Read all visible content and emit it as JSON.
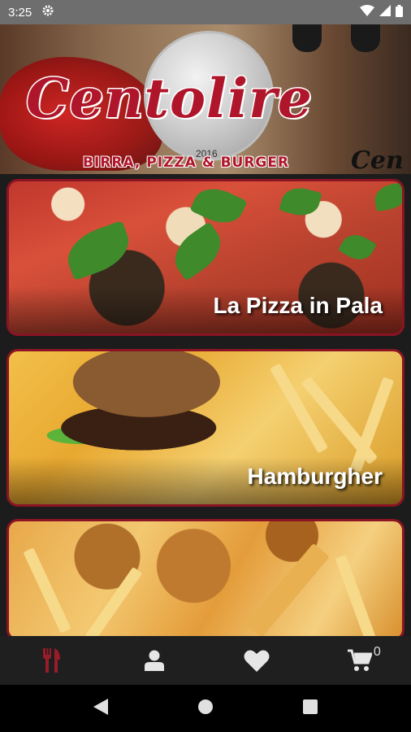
{
  "status_bar": {
    "time": "3:25",
    "icons": [
      "settings-gear-icon",
      "wifi-icon",
      "signal-icon",
      "battery-icon"
    ]
  },
  "banner": {
    "title": "Centolire",
    "subtitle": "BIRRA, PIZZA & BURGER",
    "trailing_text": "Cen",
    "coin_year": "2016"
  },
  "categories": [
    {
      "label": "La Pizza in Pala"
    },
    {
      "label": "Hamburgher"
    },
    {
      "label": ""
    }
  ],
  "bottom_nav": {
    "items": [
      "menu-fork-knife-icon",
      "user-icon",
      "heart-icon",
      "cart-icon"
    ],
    "active_color": "#9a1b2a",
    "inactive_color": "#e6e6e6",
    "cart_count": "0"
  },
  "system_nav": [
    "back-icon",
    "home-icon",
    "recents-icon"
  ]
}
